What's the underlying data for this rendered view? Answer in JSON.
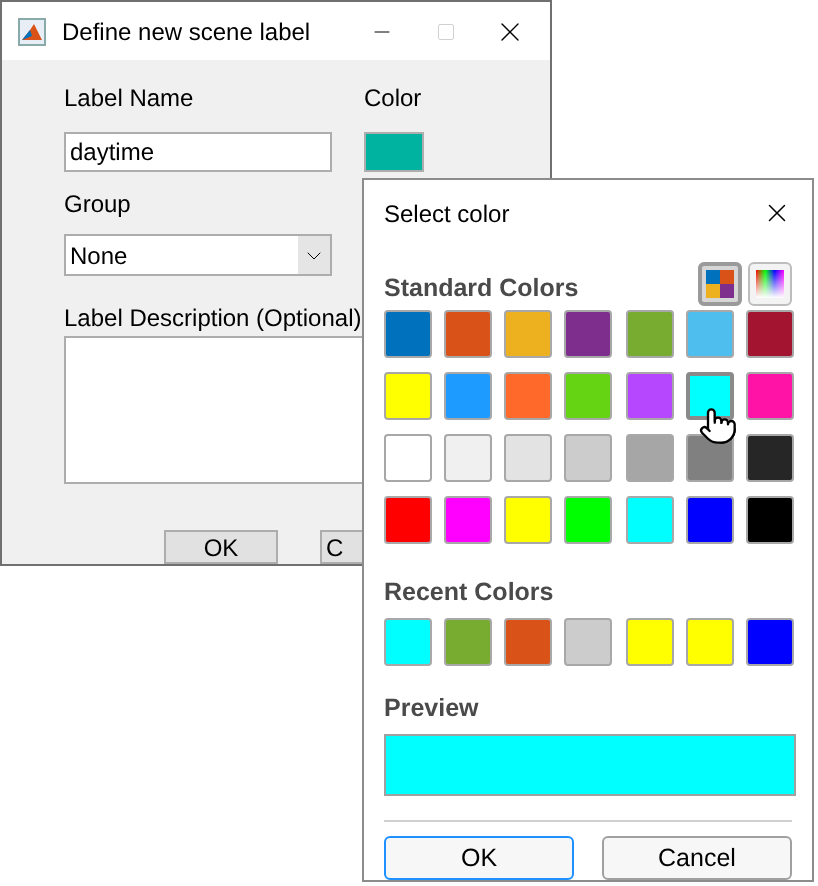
{
  "main_window": {
    "title": "Define new scene label",
    "label_name": {
      "label": "Label Name",
      "value": "daytime"
    },
    "color": {
      "label": "Color",
      "color": "#00b3a1"
    },
    "group": {
      "label": "Group",
      "value": "None"
    },
    "description": {
      "label": "Label Description (Optional)"
    },
    "buttons": [
      "OK",
      "C"
    ]
  },
  "color_picker": {
    "title": "Select color",
    "standard_label": "Standard Colors",
    "modes": [
      {
        "kind": "swatches",
        "selected": true
      },
      {
        "kind": "spectrum",
        "selected": false
      }
    ],
    "standard_colors": [
      {
        "color": "#0072bd",
        "selected": false
      },
      {
        "color": "#d95319",
        "selected": false
      },
      {
        "color": "#edb120",
        "selected": false
      },
      {
        "color": "#7e2f8e",
        "selected": false
      },
      {
        "color": "#77ac30",
        "selected": false
      },
      {
        "color": "#4dbeee",
        "selected": false
      },
      {
        "color": "#a2142f",
        "selected": false
      },
      {
        "color": "#ffff00",
        "selected": false
      },
      {
        "color": "#1e9bff",
        "selected": false
      },
      {
        "color": "#ff6929",
        "selected": false
      },
      {
        "color": "#64d413",
        "selected": false
      },
      {
        "color": "#b746ff",
        "selected": false
      },
      {
        "color": "#00ffff",
        "selected": true
      },
      {
        "color": "#ff13a6",
        "selected": false
      },
      {
        "color": "#ffffff",
        "selected": false
      },
      {
        "color": "#f0f0f0",
        "selected": false
      },
      {
        "color": "#e3e3e3",
        "selected": false
      },
      {
        "color": "#cccccc",
        "selected": false
      },
      {
        "color": "#a6a6a6",
        "selected": false
      },
      {
        "color": "#808080",
        "selected": false
      },
      {
        "color": "#262626",
        "selected": false
      },
      {
        "color": "#ff0000",
        "selected": false
      },
      {
        "color": "#ff00ff",
        "selected": false
      },
      {
        "color": "#ffff00",
        "selected": false
      },
      {
        "color": "#00ff00",
        "selected": false
      },
      {
        "color": "#00ffff",
        "selected": false
      },
      {
        "color": "#0000ff",
        "selected": false
      },
      {
        "color": "#000000",
        "selected": false
      }
    ],
    "recent_label": "Recent Colors",
    "recent_colors": [
      {
        "color": "#00ffff"
      },
      {
        "color": "#77ac30"
      },
      {
        "color": "#d95319"
      },
      {
        "color": "#cccccc"
      },
      {
        "color": "#ffff00"
      },
      {
        "color": "#ffff00"
      },
      {
        "color": "#0000ff"
      }
    ],
    "preview_label": "Preview",
    "buttons": [
      "OK",
      "Cancel"
    ]
  }
}
